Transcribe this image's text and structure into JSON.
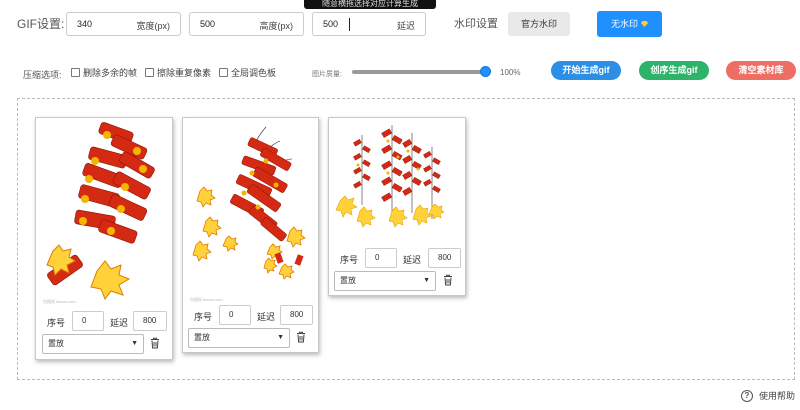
{
  "tooltip": "随意横拖选择对应计算生成",
  "gif_settings": {
    "label": "GIF设置:",
    "width": {
      "value": "340",
      "unit": "宽度(px)"
    },
    "height": {
      "value": "500",
      "unit": "高度(px)"
    },
    "delay": {
      "value": "500",
      "unit": "延迟"
    }
  },
  "watermark": {
    "label": "水印设置",
    "official_button": "官方水印",
    "none_button": "无水印"
  },
  "options": {
    "label": "压缩选项:",
    "remove_extra_frames": "删除多余的帧",
    "remove_duplicate_pixels": "擦除重复像素",
    "global_palette": "全局调色板",
    "quality_label": "图片质量:",
    "quality_value": "100%",
    "quality_fraction": 1.0
  },
  "actions": {
    "start": "开始生成gif",
    "create": "创序生成gif",
    "clear": "清空素材库"
  },
  "frames": [
    {
      "seq_label": "序号",
      "seq": "0",
      "delay_label": "延迟",
      "delay": "800",
      "mode": "置放",
      "watermark_text": "包图网 ibaotu.com"
    },
    {
      "seq_label": "序号",
      "seq": "0",
      "delay_label": "延迟",
      "delay": "800",
      "mode": "置放",
      "watermark_text": "包图网 ibaotu.com"
    },
    {
      "seq_label": "序号",
      "seq": "0",
      "delay_label": "延迟",
      "delay": "800",
      "mode": "置放",
      "watermark_text": ""
    }
  ],
  "help": "使用帮助",
  "colors": {
    "accent": "#1e90ff",
    "green": "#2db36a",
    "red": "#ee6e64",
    "firecracker_red": "#d42a14",
    "gold": "#f5b400"
  },
  "icons": [
    "diamond-icon",
    "trash-icon",
    "help-icon",
    "chevron-down-icon"
  ]
}
